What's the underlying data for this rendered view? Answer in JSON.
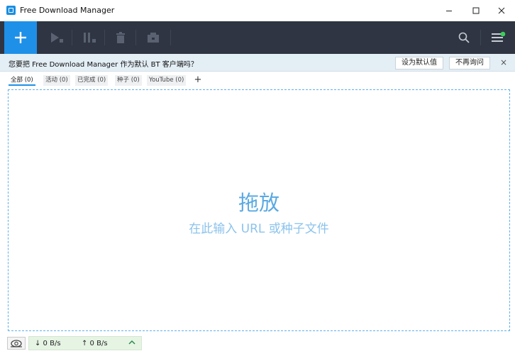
{
  "window": {
    "title": "Free Download Manager",
    "minimize_label": "–",
    "maximize_label": "☐",
    "close_label": "✕"
  },
  "toolbar": {
    "add_icon": "plus-icon",
    "buttons": [
      "play-icon",
      "pause-icon",
      "trash-icon",
      "move-icon"
    ],
    "search_icon": "search-icon",
    "menu_icon": "menu-icon",
    "accent_color": "#1e90e8",
    "background_color": "#2f3542"
  },
  "notice": {
    "text": "您要把 Free Download Manager 作为默认 BT 客户端吗？",
    "set_default_label": "设为默认值",
    "dont_ask_label": "不再询问",
    "close_label": "×"
  },
  "tabs": [
    {
      "label": "全部 (0)",
      "active": true
    },
    {
      "label": "活动 (0)",
      "active": false
    },
    {
      "label": "已完成 (0)",
      "active": false
    },
    {
      "label": "种子 (0)",
      "active": false
    },
    {
      "label": "YouTube (0)",
      "active": false
    }
  ],
  "tab_add_label": "+",
  "dropzone": {
    "title": "拖放",
    "subtitle": "在此输入 URL 或种子文件"
  },
  "statusbar": {
    "speed_mode_icon": "snail-icon",
    "download_speed": "↓ 0 B/s",
    "upload_speed": "↑ 0 B/s",
    "expand_label": "^"
  }
}
